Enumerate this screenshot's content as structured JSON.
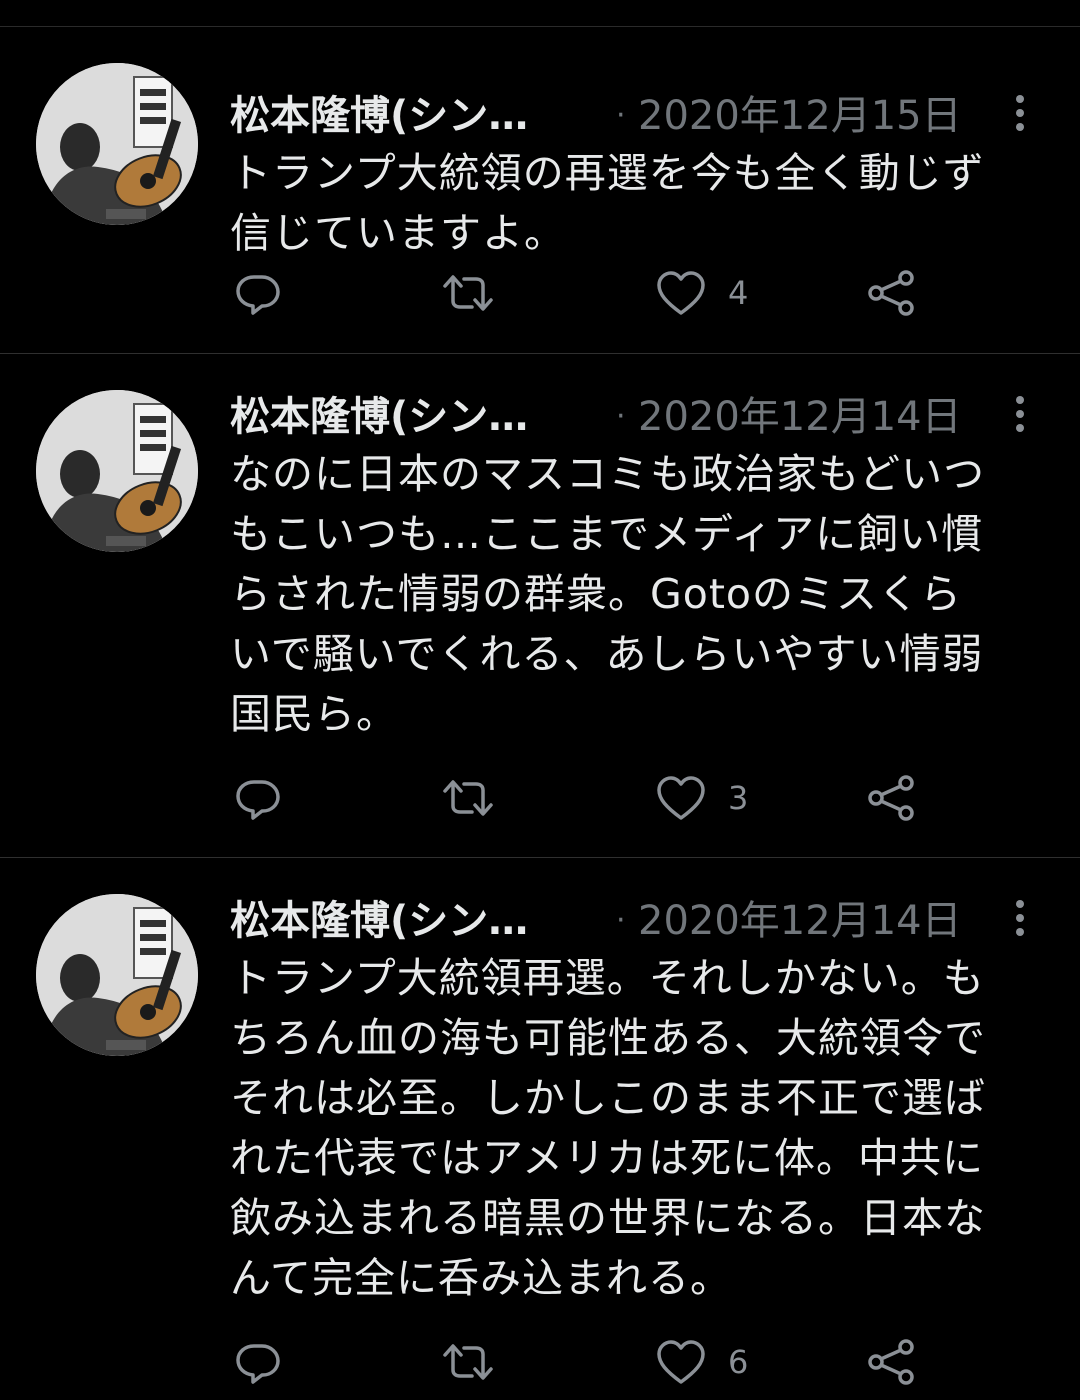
{
  "tweets": [
    {
      "author": "松本隆博(シン…",
      "date": "2020年12月15日",
      "text": "トランプ大統領の再選を今も全く動じず\n信じていますよ。",
      "likes": "4"
    },
    {
      "author": "松本隆博(シン…",
      "date": "2020年12月14日",
      "text": "なのに日本のマスコミも政治家もどいつ\nもこいつも…ここまでメディアに飼い慣\nらされた情弱の群衆。Gotoのミスくら\nいで騒いでくれる、あしらいやすい情弱\n国民ら。",
      "likes": "3"
    },
    {
      "author": "松本隆博(シン…",
      "date": "2020年12月14日",
      "text": "トランプ大統領再選。それしかない。も\nちろん血の海も可能性ある、大統領令で\nそれは必至。しかしこのまま不正で選ば\nれた代表ではアメリカは死に体。中共に\n飲み込まれる暗黒の世界になる。日本な\nんて完全に呑み込まれる。",
      "likes": "6"
    }
  ],
  "icons": {
    "reply": "reply-icon",
    "retweet": "retweet-icon",
    "like": "heart-icon",
    "share": "share-icon",
    "more": "more-vertical-icon"
  },
  "colors": {
    "background": "#000000",
    "text": "#e7e9ea",
    "secondary": "#71767b",
    "divider": "#2f2f2f"
  }
}
